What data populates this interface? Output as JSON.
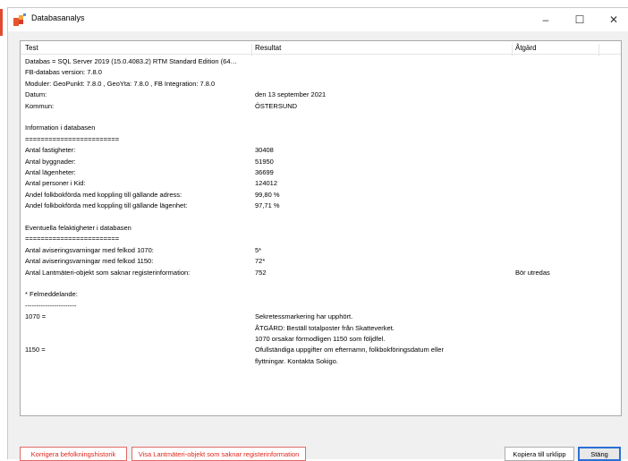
{
  "window": {
    "title": "Databasanalys"
  },
  "titlebar_buttons": {
    "minimize": "–",
    "maximize": "☐",
    "close": "✕"
  },
  "columns": [
    "Test",
    "Resultat",
    "Åtgärd"
  ],
  "rows": [
    [
      "Databas = SQL Server 2019 (15.0.4083.2) RTM Standard Edition (64…",
      "",
      ""
    ],
    [
      "FB-databas version: 7.8.0",
      "",
      ""
    ],
    [
      "Moduler: GeoPunkt: 7.8.0 , GeoYta: 7.8.0 , FB Integration: 7.8.0",
      "",
      ""
    ],
    [
      "Datum:",
      "den 13 september 2021",
      ""
    ],
    [
      "Kommun:",
      "ÖSTERSUND",
      ""
    ],
    [
      "",
      "",
      ""
    ],
    [
      "Information i databasen",
      "",
      ""
    ],
    [
      "========================",
      "",
      ""
    ],
    [
      "Antal fastigheter:",
      "30408",
      ""
    ],
    [
      "Antal byggnader:",
      "51950",
      ""
    ],
    [
      "Antal lägenheter:",
      "36699",
      ""
    ],
    [
      "Antal personer i Kid:",
      "124012",
      ""
    ],
    [
      "Andel folkbokförda med koppling till gällande adress:",
      "99,80 %",
      ""
    ],
    [
      "Andel folkbokförda med koppling till gällande lägenhet:",
      "97,71 %",
      ""
    ],
    [
      "",
      "",
      ""
    ],
    [
      "Eventuella felaktigheter i databasen",
      "",
      ""
    ],
    [
      "========================",
      "",
      ""
    ],
    [
      "Antal aviseringsvarningar med felkod 1070:",
      "5*",
      ""
    ],
    [
      "Antal aviseringsvarningar med felkod 1150:",
      "72*",
      ""
    ],
    [
      "Antal Lantmäteri-objekt som saknar registerinformation:",
      "752",
      "Bör utredas"
    ],
    [
      "",
      "",
      ""
    ],
    [
      "* Felmeddelande:",
      "",
      ""
    ],
    [
      "-----------------------",
      "",
      ""
    ],
    [
      "1070 =",
      "Sekretessmarkering har upphört.",
      ""
    ],
    [
      "",
      "ÅTGÄRD: Beställ totalposter från Skatteverket.",
      ""
    ],
    [
      "",
      "1070 orsakar förmodligen 1150 som följdfel.",
      ""
    ],
    [
      "1150 =",
      "Ofullständiga uppgifter om efternamn, folkbokföringsdatum eller",
      ""
    ],
    [
      "",
      "flyttningar. Kontakta Sokigo.",
      ""
    ]
  ],
  "buttons": {
    "korrigera": "Korrigera befolkningshistorik",
    "visa": "Visa Lantmäteri-objekt som saknar registerinformation",
    "kopiera": "Kopiera till urklipp",
    "stang": "Stäng"
  },
  "colors": {
    "accent_red": "#e0251b",
    "default_button_border": "#2a6fd6"
  }
}
